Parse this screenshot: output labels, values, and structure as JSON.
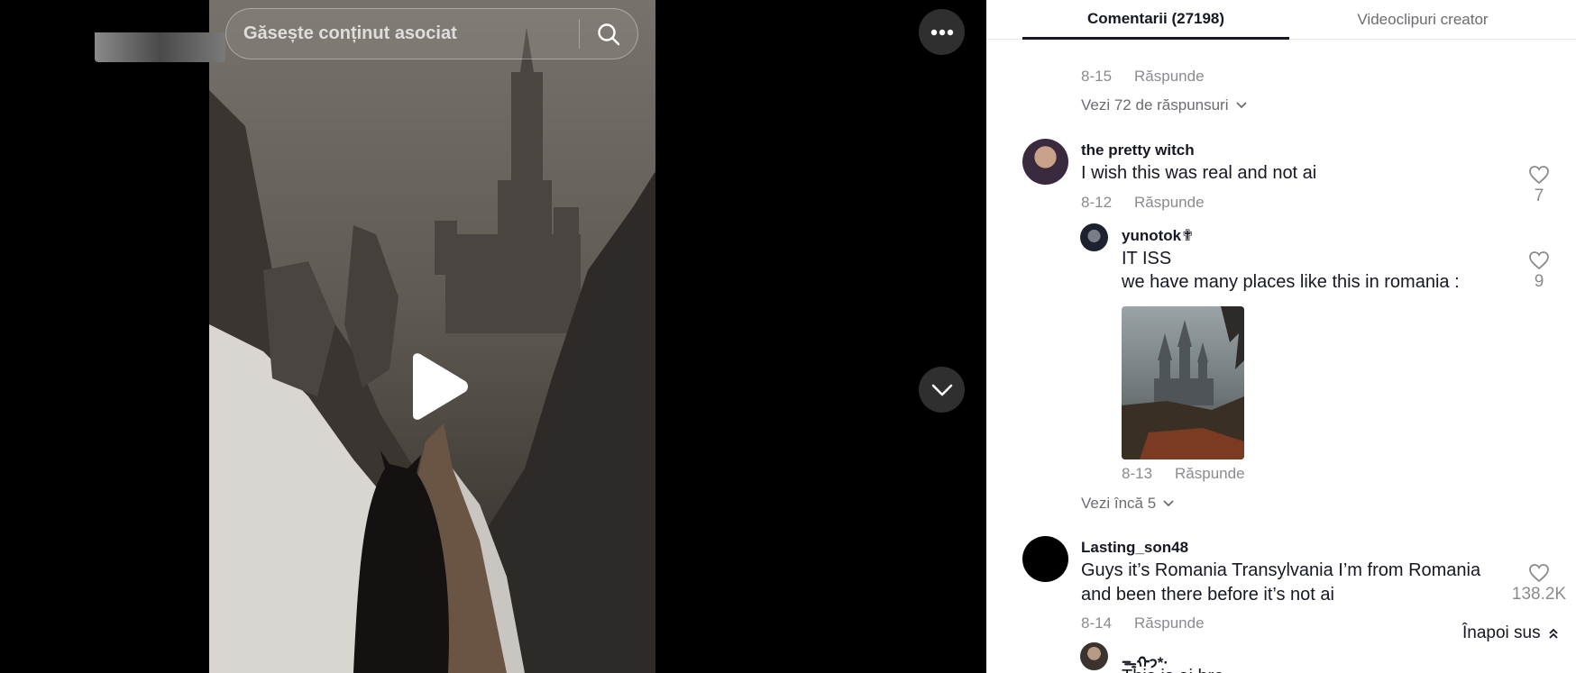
{
  "search": {
    "placeholder": "Găsește conținut asociat"
  },
  "tabs": [
    {
      "label": "Comentarii (27198)",
      "active": true
    },
    {
      "label": "Videoclipuri creator",
      "active": false
    }
  ],
  "top_partial": {
    "date": "8-15",
    "reply_label": "Răspunde",
    "view_replies": "Vezi 72 de răspunsuri"
  },
  "comments": [
    {
      "username": "the pretty witch",
      "text": "I wish this was real and not ai",
      "date": "8-12",
      "reply_label": "Răspunde",
      "likes": "7",
      "replies": [
        {
          "username": "yunotok✟",
          "text_lines": [
            "IT ISS",
            "we have many places like this in romania :"
          ],
          "date": "8-13",
          "reply_label": "Răspunde",
          "likes": "9"
        }
      ],
      "view_more": "Vezi încă 5"
    },
    {
      "username": "Lasting_son48",
      "text_lines": [
        "Guys it’s Romania Transylvania I’m from Romania",
        "and been there before it’s not ai"
      ],
      "date": "8-14",
      "reply_label": "Răspunde",
      "likes": "138.2K",
      "replies": [
        {
          "username": "ᯓᡣ𐭩*·",
          "text_partial": "This is ai bro"
        }
      ]
    }
  ],
  "back_to_top": "Înapoi sus",
  "colors": {
    "accent_text": "#161823",
    "muted": "#8a8b91",
    "background": "#ffffff"
  }
}
